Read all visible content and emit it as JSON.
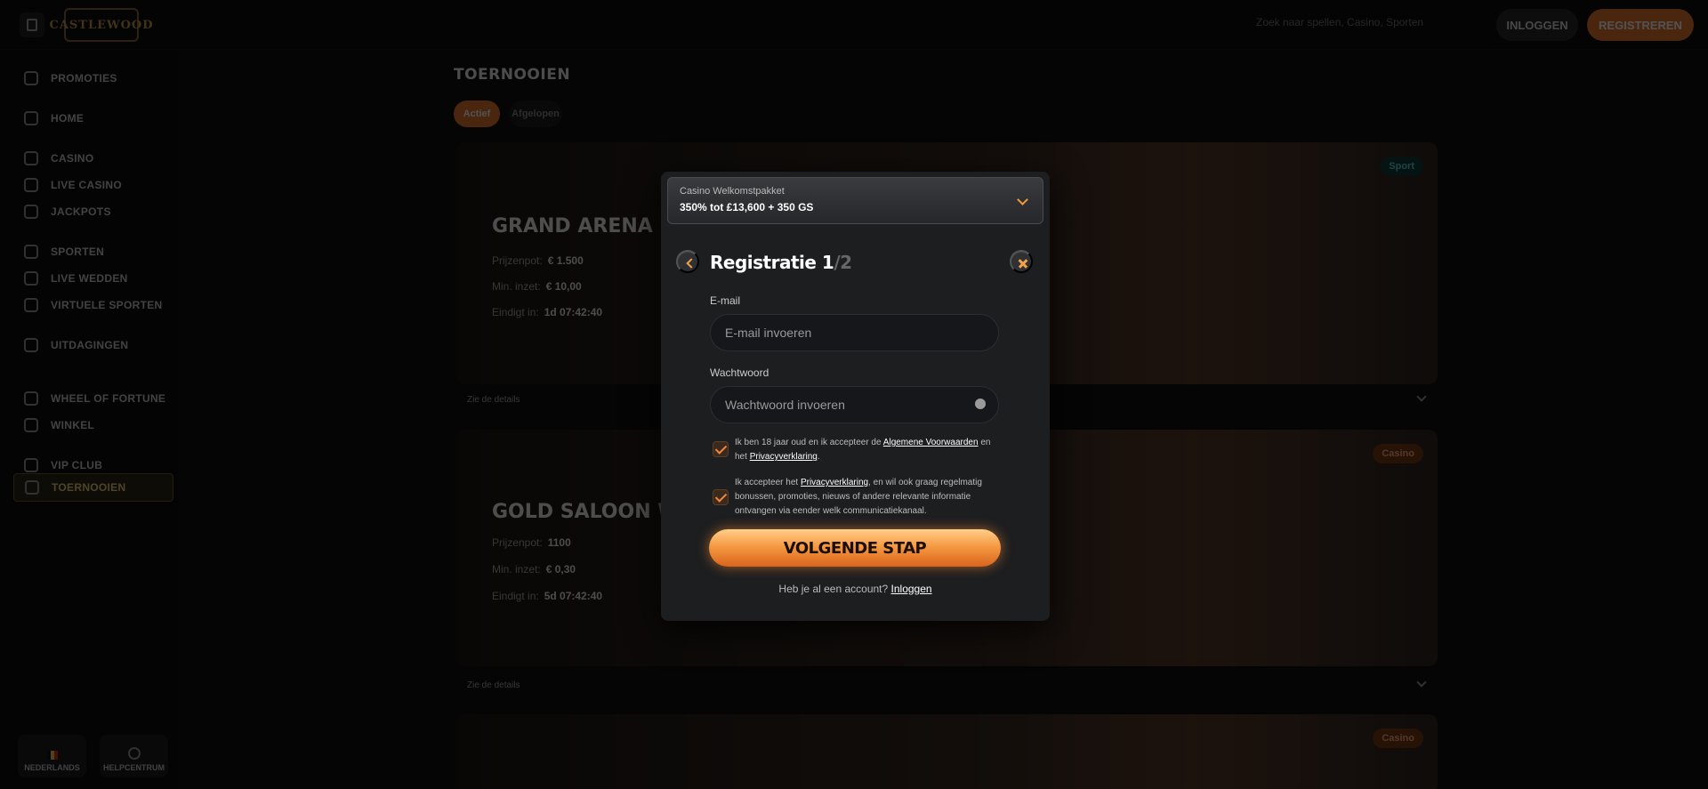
{
  "topbar": {
    "logo_text": "CASTLEWOOD",
    "search_text": "Zoek naar spellen, Casino, Sporten",
    "login_label": "INLOGGEN",
    "register_label": "REGISTREREN"
  },
  "sidebar": {
    "items": [
      {
        "label": "PROMOTIES",
        "icon": "gift-icon"
      },
      {
        "label": "HOME",
        "icon": "home-icon"
      },
      {
        "label": "CASINO",
        "icon": "casino-icon"
      },
      {
        "label": "LIVE CASINO",
        "icon": "live-casino-icon"
      },
      {
        "label": "JACKPOTS",
        "icon": "jackpot-icon"
      },
      {
        "label": "SPORTEN",
        "icon": "sports-icon"
      },
      {
        "label": "LIVE WEDDEN",
        "icon": "live-betting-icon"
      },
      {
        "label": "VIRTUELE SPORTEN",
        "icon": "virtual-sports-icon"
      },
      {
        "label": "UITDAGINGEN",
        "icon": "challenges-icon"
      },
      {
        "label": "TOERNOOIEN",
        "icon": "trophy-icon"
      },
      {
        "label": "WHEEL OF FORTUNE",
        "icon": "wheel-icon"
      },
      {
        "label": "WINKEL",
        "icon": "shop-icon"
      },
      {
        "label": "VIP CLUB",
        "icon": "diamond-icon"
      }
    ],
    "active_item": "TOERNOOIEN",
    "language_label": "NEDERLANDS",
    "help_label": "HELPCENTRUM"
  },
  "main": {
    "title": "TOERNOOIEN",
    "filters": [
      "Actief",
      "Afgelopen"
    ],
    "cards": [
      {
        "title": "GRAND ARENA",
        "badge": "Sport",
        "rows": [
          {
            "label": "Prijzenpot:",
            "value": "€ 1.500"
          },
          {
            "label": "Min. inzet:",
            "value": "€ 10,00"
          },
          {
            "label": "Eindigt in:",
            "value": "1d 07:42:40"
          }
        ],
        "details": "Zie de details"
      },
      {
        "title": "GOLD SALOON WEEKLY",
        "badge": "Casino",
        "rows": [
          {
            "label": "Prijzenpot:",
            "value": "1100"
          },
          {
            "label": "Min. inzet:",
            "value": "€ 0,30"
          },
          {
            "label": "Eindigt in:",
            "value": "5d 07:42:40"
          }
        ],
        "details": "Zie de details"
      },
      {
        "title": "",
        "badge": "Casino",
        "rows": [],
        "details": ""
      }
    ]
  },
  "modal": {
    "promo_label": "Casino Welkomstpakket",
    "promo_value": "350% tot £13,600 + 350 GS",
    "title": "Registratie 1",
    "title_total": "/2",
    "email_label": "E-mail",
    "email_placeholder": "E-mail invoeren",
    "password_label": "Wachtwoord",
    "password_placeholder": "Wachtwoord invoeren",
    "consent1_pre": "Ik ben 18 jaar oud en ik accepteer de ",
    "consent1_link1": "Algemene Voorwaarden",
    "consent1_mid": " en het ",
    "consent1_link2": "Privacyverklaring",
    "consent1_post": ".",
    "consent2_pre": "Ik accepteer het ",
    "consent2_link": "Privacyverklaring",
    "consent2_post": ", en wil ook graag regelmatig bonussen, promoties, nieuws of andere relevante informatie ontvangen via eender welk communicatiekanaal.",
    "cta_label": "VOLGENDE STAP",
    "have_account": "Heb je al een account? ",
    "login_link": "Inloggen"
  }
}
